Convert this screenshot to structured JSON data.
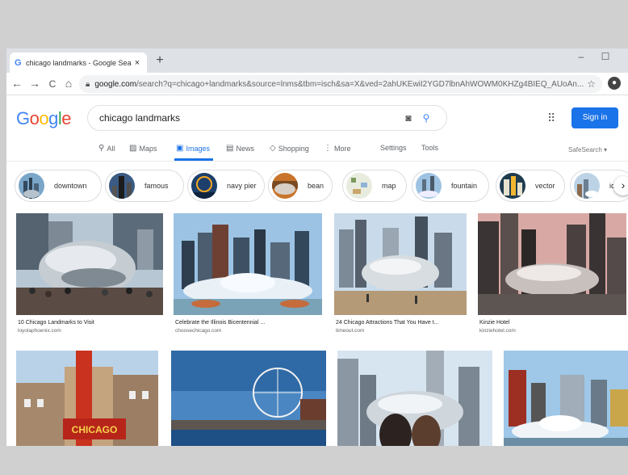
{
  "browser": {
    "tab_title": "chicago landmarks - Google Sea",
    "tab_close": "×",
    "new_tab": "+",
    "minimize": "–",
    "maximize": "☐",
    "back": "←",
    "forward": "→",
    "reload": "C",
    "home": "⌂",
    "url_host": "google.com",
    "url_path": "/search?q=chicago+landmarks&source=lnms&tbm=isch&sa=X&ved=2ahUKEwiI2YGD7lbnAhWOWM0KHZg4BIEQ_AUoAn...",
    "star": "☆",
    "profile": "●"
  },
  "google": {
    "logo": [
      {
        "ch": "G",
        "color": "#4285f4"
      },
      {
        "ch": "o",
        "color": "#ea4335"
      },
      {
        "ch": "o",
        "color": "#fbbc05"
      },
      {
        "ch": "g",
        "color": "#4285f4"
      },
      {
        "ch": "l",
        "color": "#34a853"
      },
      {
        "ch": "e",
        "color": "#ea4335"
      }
    ],
    "query": "chicago landmarks",
    "camera_icon": "◙",
    "search_icon": "⚲",
    "apps_icon": "⠿",
    "sign_in": "Sign in"
  },
  "menu": {
    "all": "All",
    "maps": "Maps",
    "images": "Images",
    "news": "News",
    "shopping": "Shopping",
    "more": "More",
    "settings": "Settings",
    "tools": "Tools",
    "safesearch": "SafeSearch ▾"
  },
  "chips": [
    {
      "label": "downtown"
    },
    {
      "label": "famous"
    },
    {
      "label": "navy pier"
    },
    {
      "label": "bean"
    },
    {
      "label": "map"
    },
    {
      "label": "fountain"
    },
    {
      "label": "vector"
    },
    {
      "label": "icc"
    }
  ],
  "chip_next": "›",
  "results": [
    {
      "caption": "10 Chicago Landmarks to Visit",
      "source": "loyolaphoenix.com"
    },
    {
      "caption": "Celebrate the Illinois Bicentennial ...",
      "source": "choosechicago.com"
    },
    {
      "caption": "24 Chicago Attractions That You Have t...",
      "source": "timeout.com"
    },
    {
      "caption": "Kinzie Hotel",
      "source": "kinziehotel.com"
    }
  ],
  "second_row": {
    "theater_sign": "CHICAGO"
  }
}
